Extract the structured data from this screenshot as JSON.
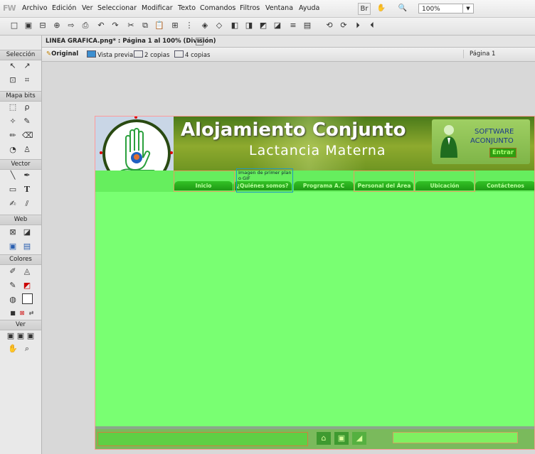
{
  "menubar": {
    "app_logo": "FW",
    "items": [
      "Archivo",
      "Edición",
      "Ver",
      "Seleccionar",
      "Modificar",
      "Texto",
      "Comandos",
      "Filtros",
      "Ventana",
      "Ayuda"
    ],
    "zoom": "100%"
  },
  "document": {
    "tab_title": "LINEA GRAFICA.png* : Página 1 al 100% (División)",
    "close_label": "x",
    "views": [
      "Original",
      "Vista previa",
      "2 copias",
      "4 copias"
    ],
    "page_label": "Página 1"
  },
  "tools": {
    "sections": [
      "Selección",
      "Mapa bits",
      "Vector",
      "Web",
      "Colores",
      "Ver"
    ]
  },
  "mockup": {
    "title": "Alojamiento Conjunto",
    "subtitle": "Lactancia Materna",
    "software_line1": "SOFTWARE",
    "software_line2": "ACONJUNTO",
    "enter_label": "Entrar",
    "tooltip_line1": "Imagen de primer plan",
    "tooltip_line2": "o GIF",
    "nav": [
      "Inicio",
      "¿Quiénes somos?",
      "Programa A.C",
      "Personal del Área",
      "Ubicación",
      "Contáctenos"
    ],
    "colors": {
      "background": "#79ff72",
      "banner": "#7a9b28",
      "nav_button": "#28ac1c",
      "enter": "#2e9e10"
    }
  }
}
